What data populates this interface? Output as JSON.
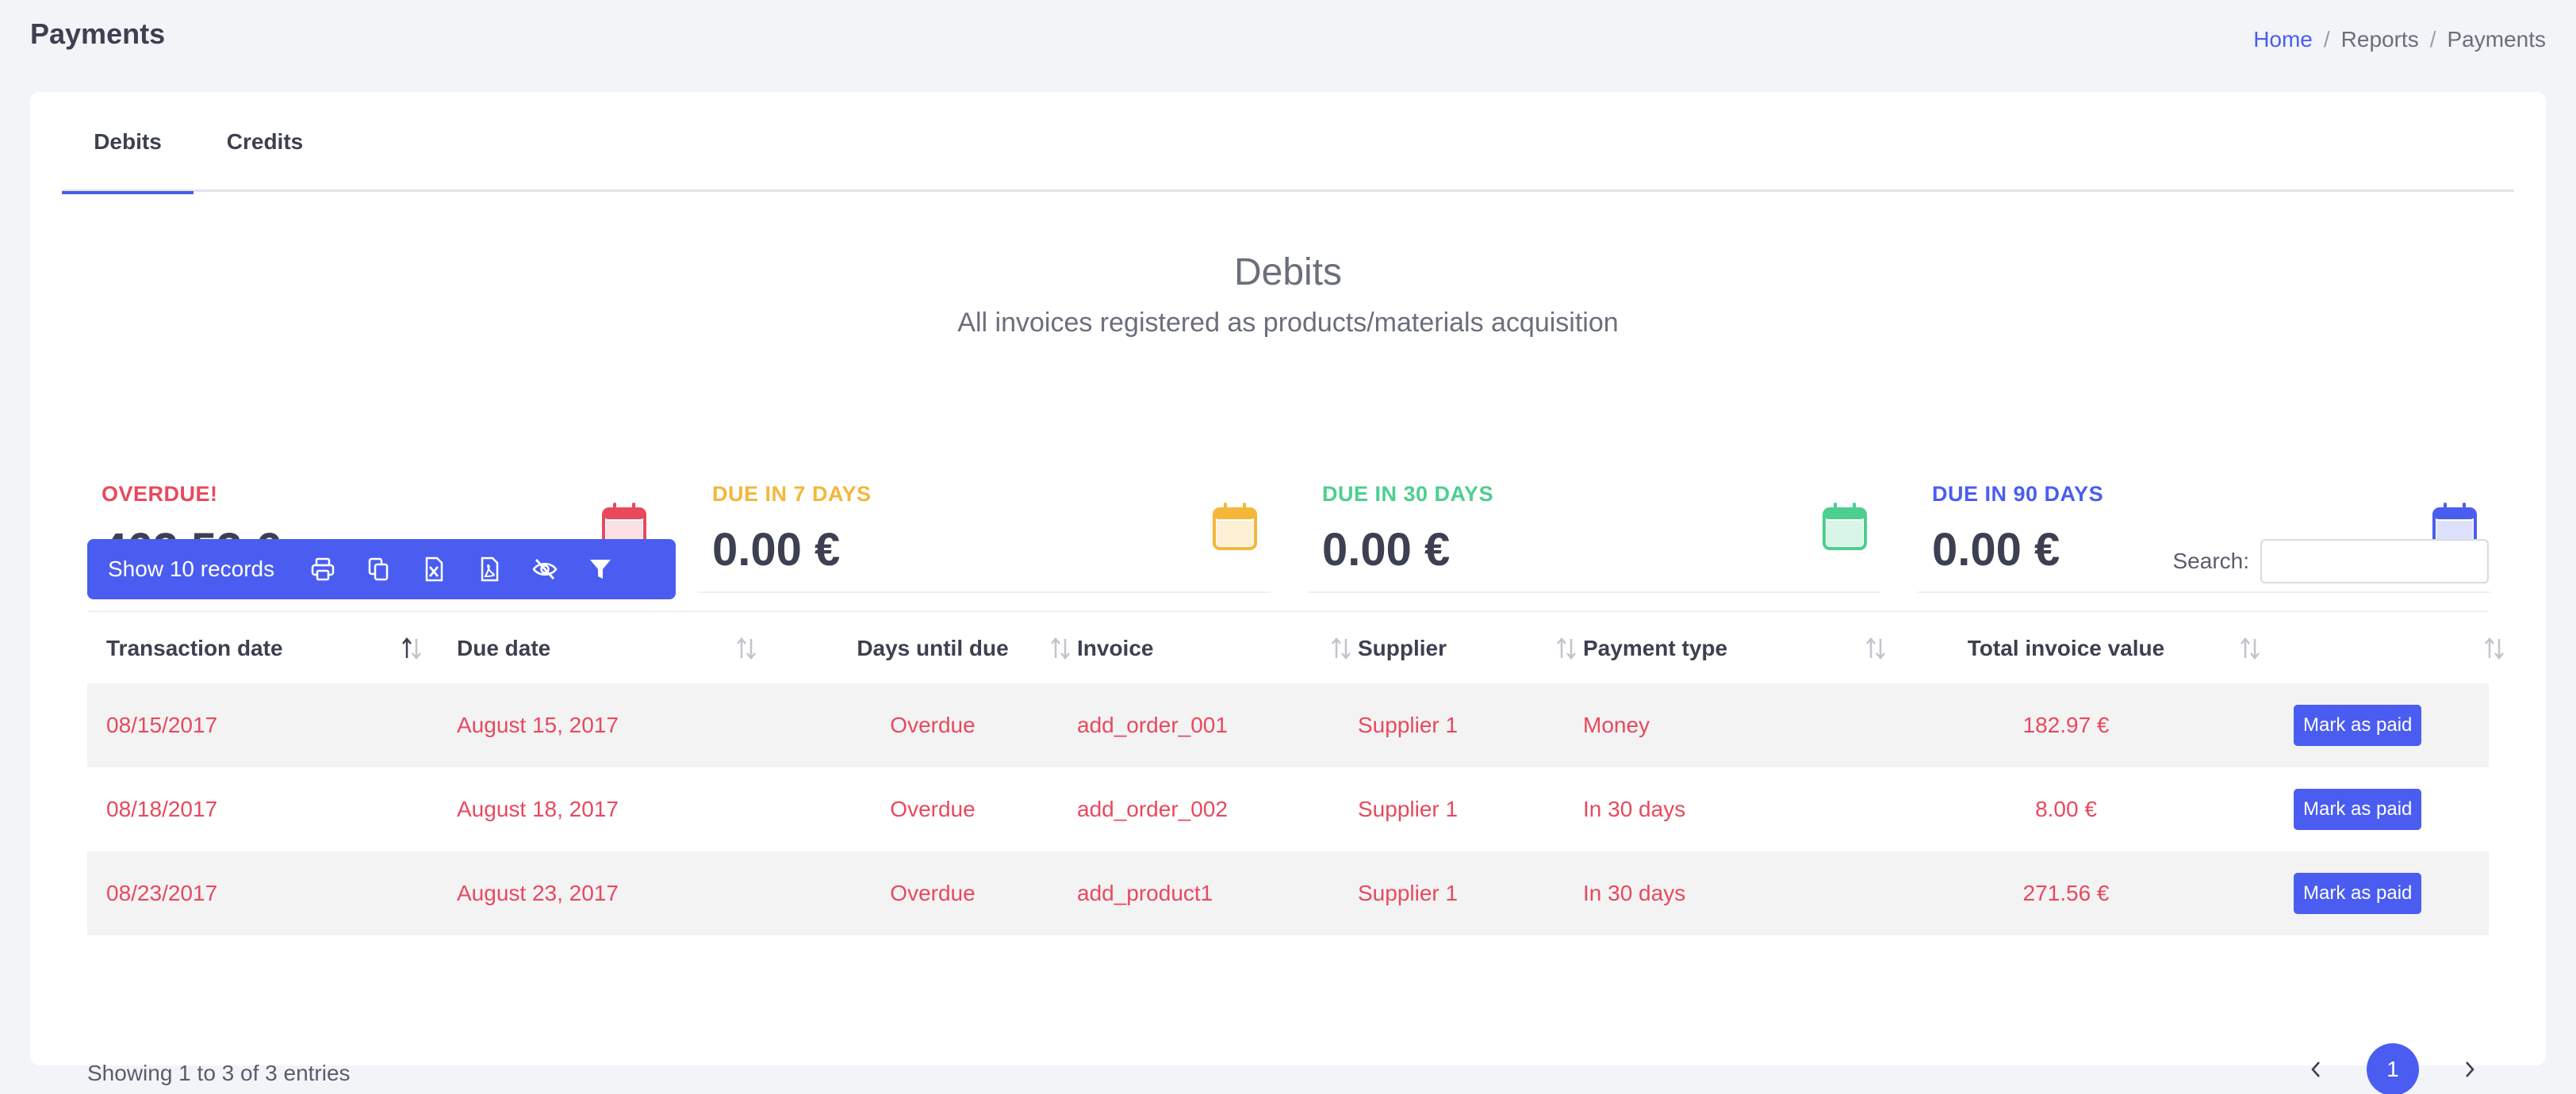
{
  "header": {
    "title": "Payments",
    "breadcrumb": [
      "Home",
      "Reports",
      "Payments"
    ]
  },
  "tabs": [
    {
      "label": "Debits",
      "active": true
    },
    {
      "label": "Credits",
      "active": false
    }
  ],
  "section": {
    "heading": "Debits",
    "subtitle": "All invoices registered as products/materials acquisition"
  },
  "stats": [
    {
      "label": "OVERDUE!",
      "value": "462.53 €",
      "color": "#e8495e"
    },
    {
      "label": "DUE IN 7 DAYS",
      "value": "0.00 €",
      "color": "#f4b73a"
    },
    {
      "label": "DUE IN 30 DAYS",
      "value": "0.00 €",
      "color": "#4ccf8f"
    },
    {
      "label": "DUE IN 90 DAYS",
      "value": "0.00 €",
      "color": "#4a5df0"
    }
  ],
  "toolbar": {
    "show_records": "Show 10 records",
    "icons": [
      "print-icon",
      "copy-icon",
      "excel-icon",
      "pdf-icon",
      "hide-columns-icon",
      "filter-icon"
    ]
  },
  "search": {
    "label": "Search:",
    "value": ""
  },
  "table": {
    "columns": [
      "Transaction date",
      "Due date",
      "Days until due",
      "Invoice",
      "Supplier",
      "Payment type",
      "Total invoice value",
      ""
    ],
    "rows": [
      {
        "transaction_date": "08/15/2017",
        "due_date": "August 15, 2017",
        "days": "Overdue",
        "invoice": "add_order_001",
        "supplier": "Supplier 1",
        "payment_type": "Money",
        "total": "182.97 €",
        "action": "Mark as paid"
      },
      {
        "transaction_date": "08/18/2017",
        "due_date": "August 18, 2017",
        "days": "Overdue",
        "invoice": "add_order_002",
        "supplier": "Supplier 1",
        "payment_type": "In 30 days",
        "total": "8.00 €",
        "action": "Mark as paid"
      },
      {
        "transaction_date": "08/23/2017",
        "due_date": "August 23, 2017",
        "days": "Overdue",
        "invoice": "add_product1",
        "supplier": "Supplier 1",
        "payment_type": "In 30 days",
        "total": "271.56 €",
        "action": "Mark as paid"
      }
    ]
  },
  "footer": {
    "info": "Showing 1 to 3 of 3 entries",
    "current_page": "1"
  },
  "colors": {
    "accent": "#4a5df0",
    "overdue": "#e8495e"
  }
}
